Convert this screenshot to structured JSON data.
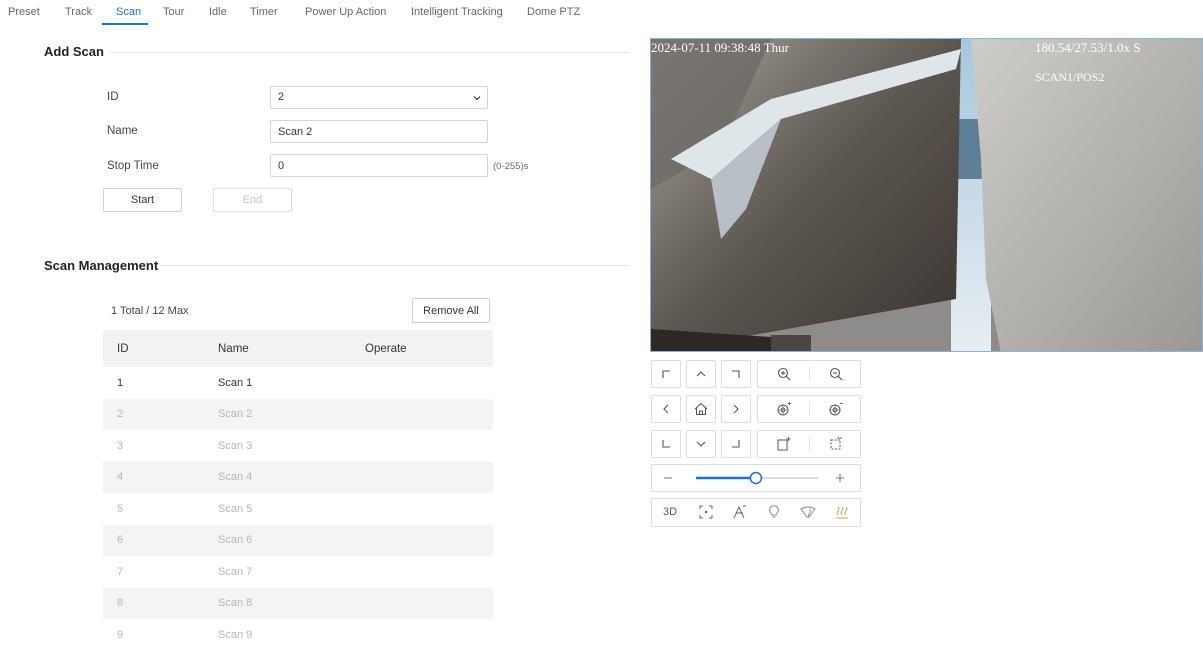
{
  "tabs": [
    {
      "label": "Preset"
    },
    {
      "label": "Track"
    },
    {
      "label": "Scan"
    },
    {
      "label": "Tour"
    },
    {
      "label": "Idle"
    },
    {
      "label": "Timer"
    },
    {
      "label": "Power Up Action"
    },
    {
      "label": "Intelligent Tracking"
    },
    {
      "label": "Dome PTZ"
    }
  ],
  "active_tab": "Scan",
  "add_scan": {
    "title": "Add Scan",
    "id_label": "ID",
    "id_value": "2",
    "name_label": "Name",
    "name_value": "Scan 2",
    "stop_time_label": "Stop Time",
    "stop_time_value": "0",
    "stop_time_hint": "(0-255)s",
    "start_label": "Start",
    "end_label": "End"
  },
  "scan_management": {
    "title": "Scan Management",
    "total_text": "1 Total / 12 Max",
    "remove_all_label": "Remove All",
    "columns": {
      "id": "ID",
      "name": "Name",
      "operate": "Operate"
    },
    "rows": [
      {
        "id": "1",
        "name": "Scan 1"
      },
      {
        "id": "2",
        "name": "Scan 2"
      },
      {
        "id": "3",
        "name": "Scan 3"
      },
      {
        "id": "4",
        "name": "Scan 4"
      },
      {
        "id": "5",
        "name": "Scan 5"
      },
      {
        "id": "6",
        "name": "Scan 6"
      },
      {
        "id": "7",
        "name": "Scan 7"
      },
      {
        "id": "8",
        "name": "Scan 8"
      },
      {
        "id": "9",
        "name": "Scan 9"
      }
    ]
  },
  "video": {
    "timestamp": "2024-07-11 09:38:48 Thur",
    "ptz_readout": "180.54/27.53/1.0x S",
    "scan_status": "SCAN1/POS2"
  },
  "ptz": {
    "zoom_slider_level": 0.45,
    "function_3d_label": "3D"
  },
  "colors": {
    "accent": "#1f6fcf",
    "disabled_text": "#b7b7b7"
  }
}
